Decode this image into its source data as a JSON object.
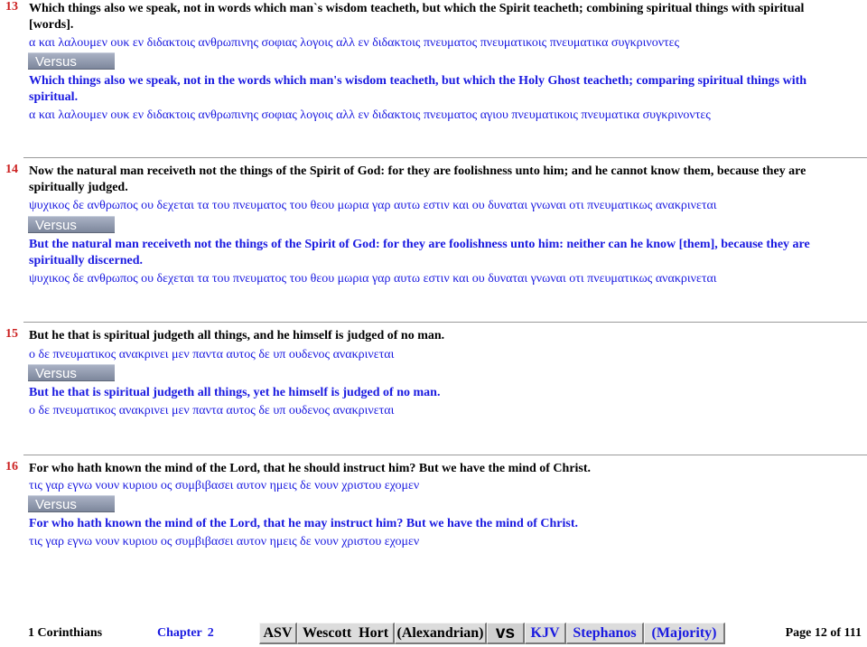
{
  "verses": [
    {
      "num": "13",
      "kjv": [
        "Which things also we speak, not in words which man`s wisdom teacheth, but which the Spirit teacheth; combining spiritual things with spiritual",
        "[words]."
      ],
      "greek1": "α και λαλουμεν ουκ εν διδακτοις ανθρωπινης σοφιας λογοις αλλ εν διδακτοις πνευματος πνευματικοις πνευματικα συγκρινοντες",
      "versus": "Versus",
      "alt": [
        "Which things also we speak, not in the words which man's wisdom teacheth, but which the Holy Ghost teacheth; comparing spiritual things with",
        "spiritual."
      ],
      "greek2": "α και λαλουμεν ουκ εν διδακτοις ανθρωπινης σοφιας λογοις αλλ εν διδακτοις πνευματος αγιου πνευματικοις πνευματικα συγκρινοντες"
    },
    {
      "num": "14",
      "kjv": [
        "Now the natural man receiveth not the things of the Spirit of God: for they are foolishness unto him; and he cannot know them, because they are",
        "spiritually judged."
      ],
      "greek1": "ψυχικος δε ανθρωπος ου δεχεται τα του πνευματος του θεου μωρια γαρ αυτω εστιν και ου δυναται γνωναι οτι πνευματικως ανακρινεται",
      "versus": "Versus",
      "alt": [
        "But the natural man receiveth not the things of the Spirit of God: for they are foolishness unto him: neither can he know [them], because they are",
        "spiritually discerned."
      ],
      "greek2": "ψυχικος δε ανθρωπος ου δεχεται τα του πνευματος του θεου μωρια γαρ αυτω εστιν και ου δυναται γνωναι οτι πνευματικως ανακρινεται"
    },
    {
      "num": "15",
      "kjv": [
        "But he that is spiritual judgeth all things, and he himself is judged of no man."
      ],
      "greek1": "ο δε πνευματικος ανακρινει μεν παντα αυτος δε υπ ουδενος ανακρινεται",
      "versus": "Versus",
      "alt": [
        "But he that is spiritual judgeth all things, yet he himself is judged of no man."
      ],
      "greek2": "ο δε πνευματικος ανακρινει μεν παντα αυτος δε υπ ουδενος ανακρινεται"
    },
    {
      "num": "16",
      "kjv": [
        "For who hath known the mind of the Lord, that he should instruct him? But we have the mind of Christ."
      ],
      "greek1": "τις γαρ εγνω νουν κυριου ος συμβιβασει αυτον ημεις δε νουν χριστου εχομεν",
      "versus": "Versus",
      "alt": [
        "For who hath known the mind of the Lord, that he may instruct him? But we have the mind of Christ."
      ],
      "greek2": "τις γαρ εγνω νουν κυριου ος συμβιβασει αυτον ημεις δε νουν χριστου εχομεν"
    }
  ],
  "footer": {
    "book": "1 Corinthians",
    "chapter_label": "Chapter",
    "chapter_num": "2",
    "tabs": [
      "ASV",
      "Wescott  Hort",
      "(Alexandrian)",
      "vs",
      "KJV",
      "Stephanos",
      "(Majority)"
    ],
    "page": "Page 12 of 111"
  },
  "colors": {
    "verse_number": "#cc2222",
    "alt_text": "#1a1ae0",
    "versus_bar": "#8e97ab"
  }
}
